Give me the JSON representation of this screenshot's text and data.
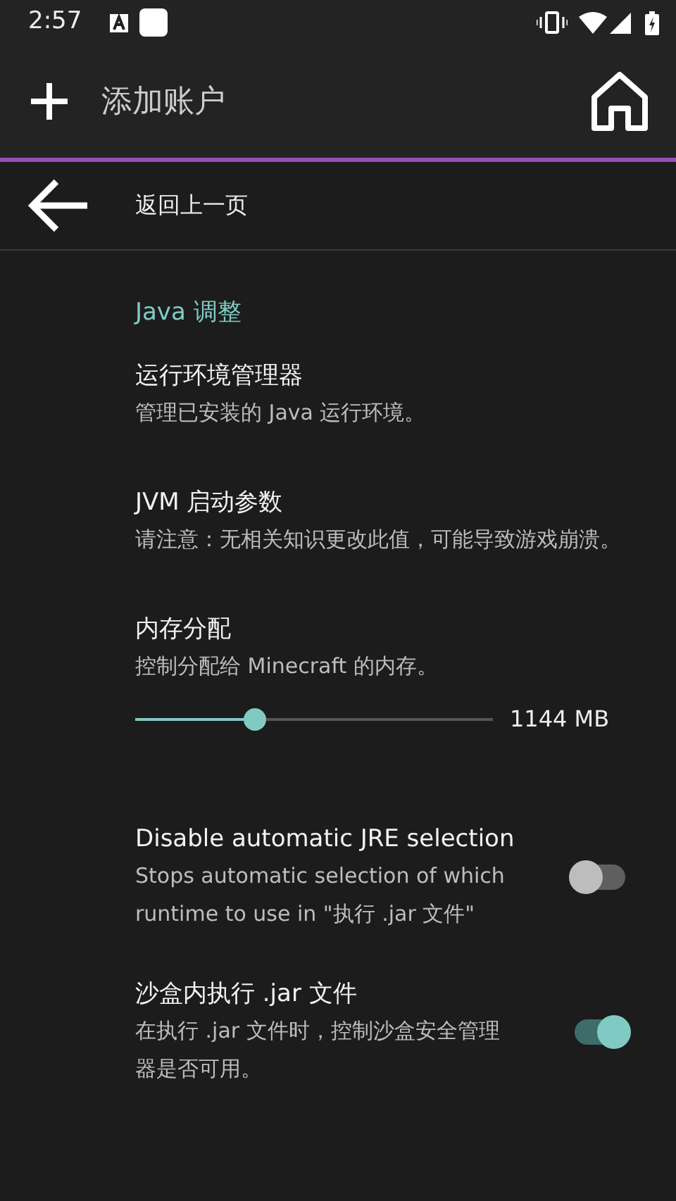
{
  "status_bar": {
    "time": "2:57"
  },
  "toolbar": {
    "title": "添加账户"
  },
  "back_row": {
    "label": "返回上一页"
  },
  "section": {
    "title": "Java 调整"
  },
  "settings": [
    {
      "kind": "text",
      "title": "运行环境管理器",
      "summary": "管理已安装的 Java 运行环境。"
    },
    {
      "kind": "text",
      "title": "JVM 启动参数",
      "summary": "请注意：无相关知识更改此值，可能导致游戏崩溃。"
    },
    {
      "kind": "slider",
      "title": "内存分配",
      "summary": "控制分配给 Minecraft 的内存。",
      "level": 0.335,
      "reading": "1144 MB"
    },
    {
      "kind": "switch",
      "title": "Disable automatic JRE selection",
      "summary": "Stops automatic selection of which runtime to use in \"执行 .jar 文件\"",
      "on": false
    },
    {
      "kind": "switch",
      "title": "沙盒内执行 .jar 文件",
      "summary": "在执行 .jar 文件时，控制沙盒安全管理器是否可用。",
      "on": true
    }
  ]
}
